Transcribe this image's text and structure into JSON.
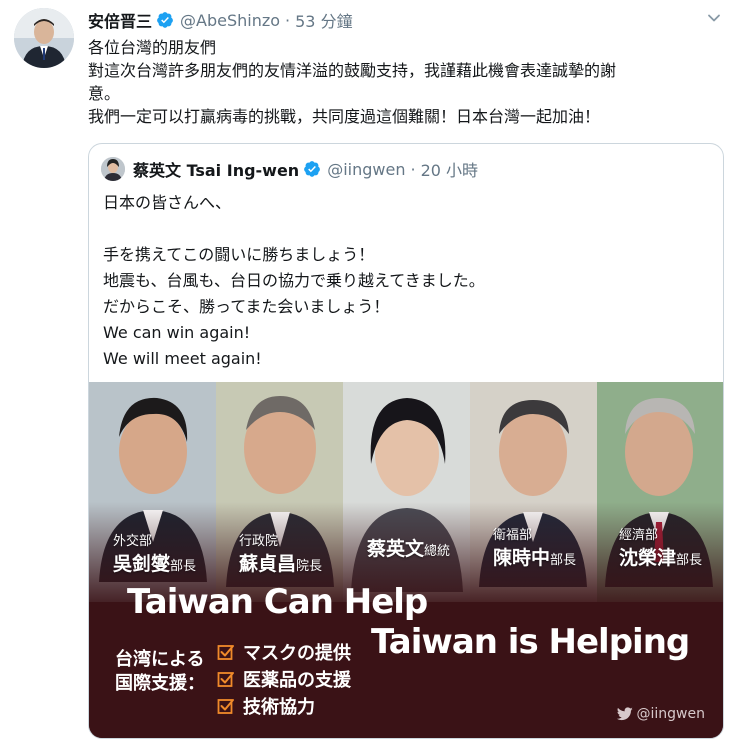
{
  "tweet": {
    "author_name": "安倍晋三",
    "author_handle": "@AbeShinzo",
    "separator": "·",
    "time": "53 分鐘",
    "lines": [
      "各位台灣的朋友們",
      "對這次台灣許多朋友們的友情洋溢的鼓勵支持，我謹藉此機會表達誠摯的謝",
      "意。",
      "我們一定可以打贏病毒的挑戰，共同度過這個難關！日本台灣一起加油！"
    ]
  },
  "quoted": {
    "author_name": "蔡英文 Tsai Ing-wen",
    "author_handle": "@iingwen",
    "separator": "·",
    "time": "20 小時",
    "lines": [
      "日本の皆さんへ、",
      "",
      "手を携えてこの闘いに勝ちましょう！",
      "地震も、台風も、台日の協力で乗り越えてきました。",
      "だからこそ、勝ってまた会いましょう！",
      "We can win again!",
      "We will meet again!"
    ]
  },
  "media": {
    "people": [
      {
        "title": "外交部",
        "name": "吳釗燮",
        "rank": "部長"
      },
      {
        "title": "行政院",
        "name": "蘇貞昌",
        "rank": "院長"
      },
      {
        "title": "",
        "name": "蔡英文",
        "rank": "總統"
      },
      {
        "title": "衛福部",
        "name": "陳時中",
        "rank": "部長"
      },
      {
        "title": "經濟部",
        "name": "沈榮津",
        "rank": "部長"
      }
    ],
    "slogan_1": "Taiwan Can Help",
    "slogan_2": "Taiwan is Helping",
    "support_heading_1": "台湾による",
    "support_heading_2": "国際支援：",
    "support_items": [
      "マスクの提供",
      "医薬品の支援",
      "技術協力"
    ],
    "watermark": "@iingwen"
  },
  "colors": {
    "verified": "#1da1f2",
    "text": "#14171a",
    "muted": "#657786",
    "border": "#ccd6dd",
    "media_background": "#3a1216",
    "checkbox": "#f08a2a"
  },
  "icons": {
    "verified": "verified-badge-icon",
    "caret": "chevron-down-icon",
    "checkbox": "checkbox-checked-icon",
    "twitter": "twitter-bird-icon"
  }
}
